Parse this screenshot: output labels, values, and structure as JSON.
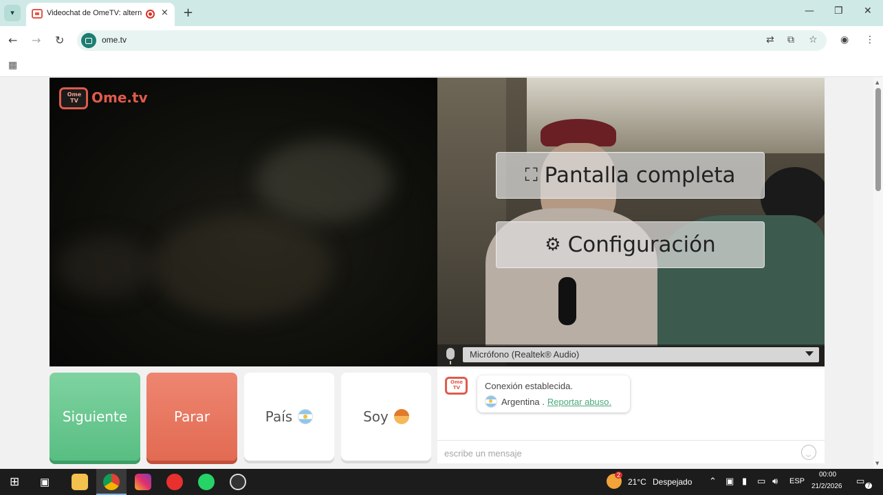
{
  "browser": {
    "tab_title": "Videochat de OmeTV: altern",
    "tab_close": "×",
    "new_tab": "+",
    "url": "ome.tv",
    "window_controls": {
      "minimize": "—",
      "restore": "❐",
      "close": "✕"
    }
  },
  "logo": {
    "badge": "Ome TV",
    "text": "Ome.tv"
  },
  "video": {
    "fullscreen_label": "Pantalla completa",
    "settings_label": "Configuración",
    "microphone": "Micrófono (Realtek® Audio)"
  },
  "controls": {
    "next": "Siguiente",
    "stop": "Parar",
    "country": "País",
    "soy": "Soy"
  },
  "chat": {
    "logo_badge": "Ome TV",
    "status": "Conexión establecida.",
    "country": "Argentina .",
    "report": "Reportar abuso.",
    "placeholder": "escribe un mensaje"
  },
  "taskbar": {
    "weather_badge": "2",
    "temperature": "21°C",
    "weather": "Despejado",
    "language": "ESP",
    "time": "00:00",
    "date": "21/2/2026",
    "notifications": "7"
  },
  "colors": {
    "next_button": "#58be82",
    "stop_button": "#e26a52",
    "brand": "#e05a4c",
    "link": "#4aa87a"
  }
}
